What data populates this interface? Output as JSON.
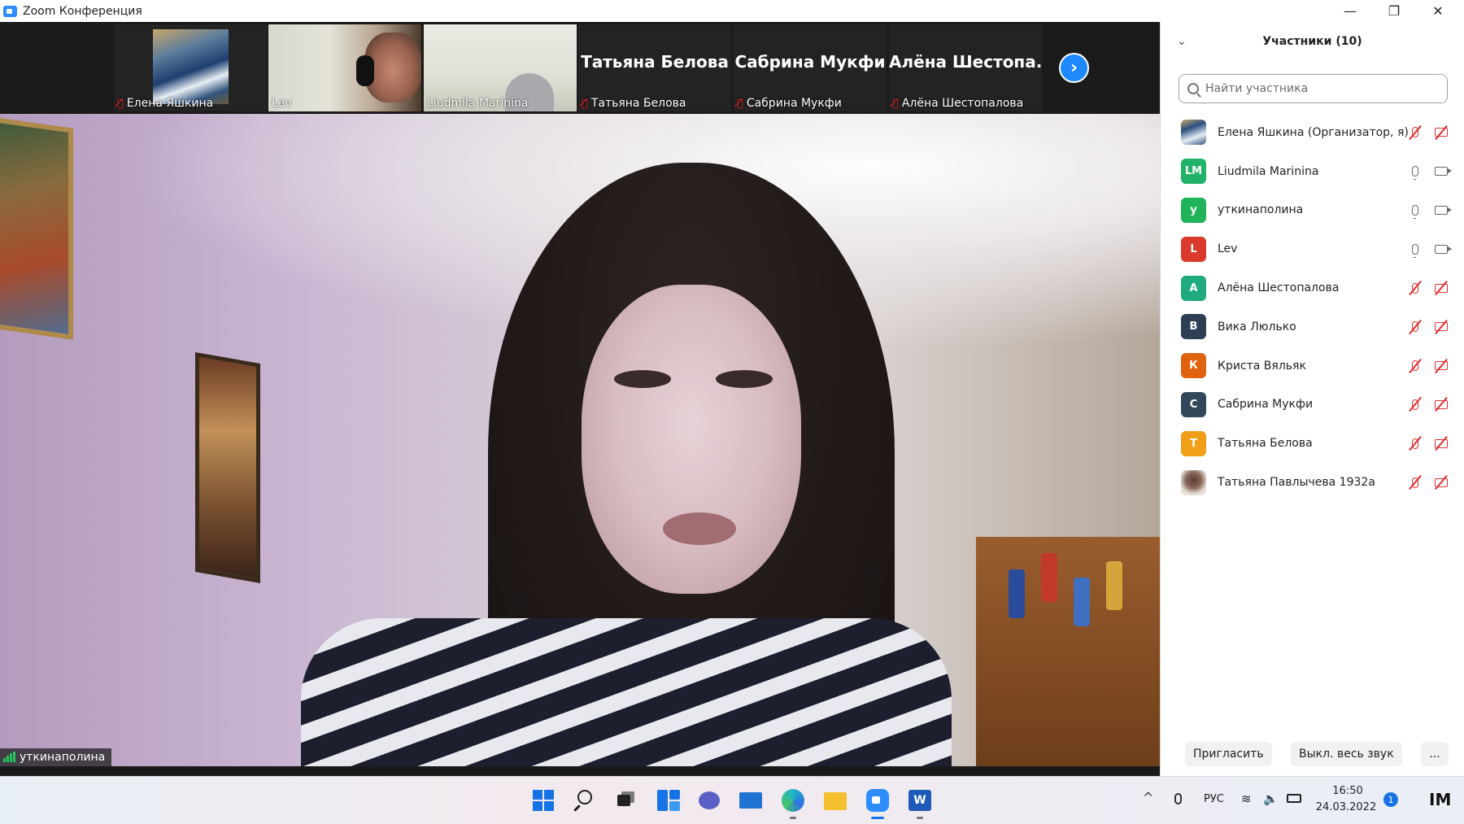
{
  "window": {
    "title": "Zoom Конференция",
    "minimize": "—",
    "restore": "❐",
    "close": "✕"
  },
  "thumbnails": [
    {
      "name": "Елена Яшкина",
      "muted": true,
      "video": true
    },
    {
      "name": "Lev",
      "muted": false,
      "video": true
    },
    {
      "name": "Liudmila Marinina",
      "muted": false,
      "video": true
    },
    {
      "name": "Татьяна Белова",
      "display": "Татьяна Белова",
      "muted": true,
      "video": false
    },
    {
      "name": "Сабрина Мукфи",
      "display": "Сабрина Мукфи",
      "muted": true,
      "video": false
    },
    {
      "name": "Алёна Шестопалова",
      "display": "Алёна  Шестопа...",
      "muted": true,
      "video": false
    }
  ],
  "main_video": {
    "speaker_name": "уткинаполина"
  },
  "panel": {
    "title": "Участники (10)",
    "collapse_icon": "⌄",
    "search_placeholder": "Найти участника",
    "participants": [
      {
        "name": "Елена Яшкина (Организатор, я)",
        "initials": "",
        "color": "#5a7ea8",
        "mic": "off",
        "cam": "off",
        "photo": true
      },
      {
        "name": "Liudmila Marinina",
        "initials": "LM",
        "color": "#21b26a",
        "mic": "on",
        "cam": "on"
      },
      {
        "name": "уткинаполина",
        "initials": "у",
        "color": "#1fb35a",
        "mic": "on",
        "cam": "on"
      },
      {
        "name": "Lev",
        "initials": "L",
        "color": "#d93a2b",
        "mic": "on",
        "cam": "on"
      },
      {
        "name": "Алёна Шестопалова",
        "initials": "А",
        "color": "#1faa7f",
        "mic": "off",
        "cam": "off"
      },
      {
        "name": "Вика Люлько",
        "initials": "В",
        "color": "#2e3f55",
        "mic": "off",
        "cam": "off"
      },
      {
        "name": "Криста Вяльяк",
        "initials": "К",
        "color": "#e0620e",
        "mic": "off",
        "cam": "off"
      },
      {
        "name": "Сабрина Мукфи",
        "initials": "С",
        "color": "#33475b",
        "mic": "off",
        "cam": "off"
      },
      {
        "name": "Татьяна Белова",
        "initials": "Т",
        "color": "#f0a018",
        "mic": "off",
        "cam": "off"
      },
      {
        "name": "Татьяна Павлычева 1932а",
        "initials": "",
        "color": "#c8c2b4",
        "mic": "off",
        "cam": "off",
        "photo": true
      }
    ],
    "invite_label": "Пригласить",
    "mute_all_label": "Выкл. весь звук",
    "more_label": "..."
  },
  "taskbar": {
    "tray_chevron": "^",
    "language": "РУС",
    "wifi": "≋",
    "volume": "🔈",
    "time": "16:50",
    "date": "24.03.2022",
    "notifications": "1",
    "word_letter": "W",
    "brand": "IM"
  },
  "colors": {
    "zoom_blue": "#2d8cff",
    "muted_red": "#e03030",
    "windows_blue": "#1673e6"
  }
}
